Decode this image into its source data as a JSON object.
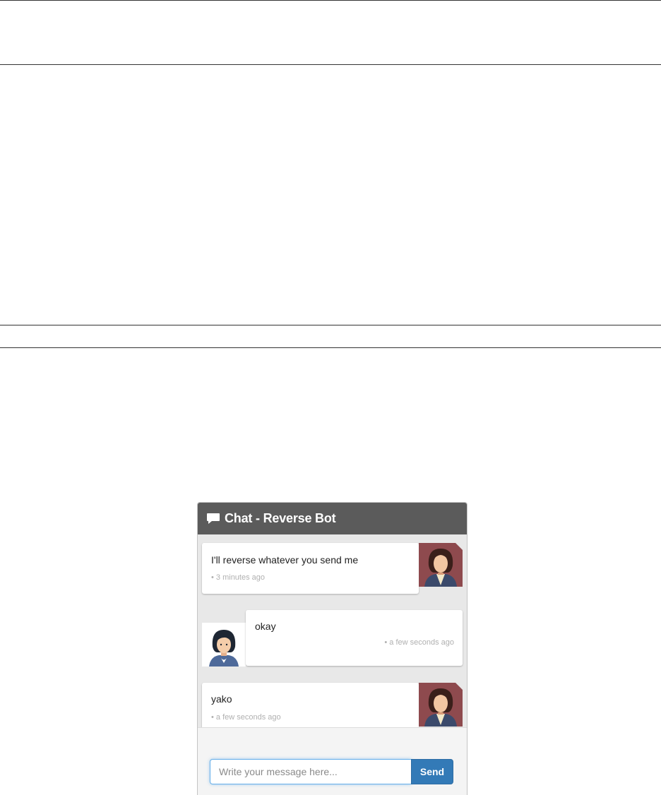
{
  "chat": {
    "title": "Chat - Reverse Bot",
    "header_icon": "comment-icon",
    "messages": [
      {
        "sender": "bot",
        "text": "I'll reverse whatever you send me",
        "time": "• 3 minutes ago",
        "avatar": "bot-avatar"
      },
      {
        "sender": "user",
        "text": "okay",
        "time": "• a few seconds ago",
        "avatar": "user-avatar"
      },
      {
        "sender": "bot",
        "text": "yako",
        "time": "• a few seconds ago",
        "avatar": "bot-avatar"
      }
    ],
    "input": {
      "placeholder": "Write your message here...",
      "value": ""
    },
    "send_label": "Send"
  },
  "colors": {
    "header_bg": "#5b5b5b",
    "chat_bg": "#e8e8e8",
    "send_button": "#337ab7",
    "input_focus": "#66afe9",
    "bot_avatar_bg": "#8e4a4e"
  }
}
